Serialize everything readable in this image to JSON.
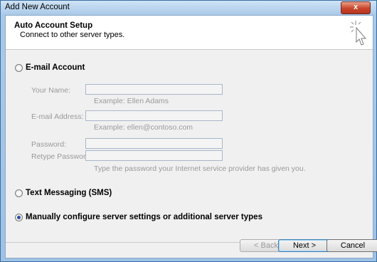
{
  "window": {
    "title": "Add New Account",
    "close_label": "x"
  },
  "header": {
    "title": "Auto Account Setup",
    "subtitle": "Connect to other server types.",
    "icon": "cursor-sparkle-icon"
  },
  "email_account": {
    "label": "E-mail Account",
    "your_name_label": "Your Name:",
    "your_name_value": "",
    "your_name_example": "Example: Ellen Adams",
    "email_label": "E-mail Address:",
    "email_value": "",
    "email_example": "Example: ellen@contoso.com",
    "password_label": "Password:",
    "password_value": "",
    "retype_label": "Retype Password:",
    "retype_value": "",
    "password_help": "Type the password your Internet service provider has given you."
  },
  "sms": {
    "label": "Text Messaging (SMS)"
  },
  "manual": {
    "label": "Manually configure server settings or additional server types"
  },
  "buttons": {
    "back": "< Back",
    "next": "Next >",
    "cancel": "Cancel"
  }
}
